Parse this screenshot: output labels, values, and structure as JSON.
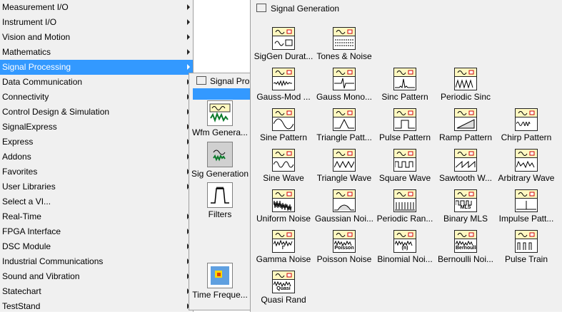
{
  "menu": {
    "items": [
      {
        "label": "Measurement I/O",
        "submenu": true
      },
      {
        "label": "Instrument I/O",
        "submenu": true
      },
      {
        "label": "Vision and Motion",
        "submenu": true
      },
      {
        "label": "Mathematics",
        "submenu": true
      },
      {
        "label": "Signal Processing",
        "submenu": true,
        "selected": true
      },
      {
        "label": "Data Communication",
        "submenu": true
      },
      {
        "label": "Connectivity",
        "submenu": true
      },
      {
        "label": "Control Design & Simulation",
        "submenu": true
      },
      {
        "label": "SignalExpress",
        "submenu": true
      },
      {
        "label": "Express",
        "submenu": true
      },
      {
        "label": "Addons",
        "submenu": true
      },
      {
        "label": "Favorites",
        "submenu": true
      },
      {
        "label": "User Libraries",
        "submenu": true
      },
      {
        "label": "Select a VI...",
        "submenu": false
      },
      {
        "label": "Real-Time",
        "submenu": true
      },
      {
        "label": "FPGA Interface",
        "submenu": true
      },
      {
        "label": "DSC Module",
        "submenu": true
      },
      {
        "label": "Industrial Communications",
        "submenu": true
      },
      {
        "label": "Sound and Vibration",
        "submenu": true
      },
      {
        "label": "Statechart",
        "submenu": true
      },
      {
        "label": "TestStand",
        "submenu": true
      }
    ]
  },
  "subpalette": {
    "title": "Signal Pro",
    "items": [
      {
        "label": "Wfm Genera...",
        "icon": "waveform-generation-icon"
      },
      {
        "label": "Sig Generation",
        "icon": "signal-generation-icon"
      },
      {
        "label": "Filters",
        "icon": "filters-icon"
      },
      {
        "label": "Time Freque...",
        "icon": "time-frequency-icon"
      }
    ]
  },
  "palette": {
    "title": "Signal Generation",
    "items": [
      {
        "label": "SigGen Durat...",
        "icon": "siggen-duration-icon",
        "row": 0,
        "col": 0
      },
      {
        "label": "Tones & Noise",
        "icon": "tones-noise-icon",
        "row": 0,
        "col": 1
      },
      {
        "label": "Gauss-Mod ...",
        "icon": "gauss-mod-icon",
        "row": 1,
        "col": 0
      },
      {
        "label": "Gauss Mono...",
        "icon": "gauss-mono-icon",
        "row": 1,
        "col": 1
      },
      {
        "label": "Sinc Pattern",
        "icon": "sinc-pattern-icon",
        "row": 1,
        "col": 2
      },
      {
        "label": "Periodic Sinc",
        "icon": "periodic-sinc-icon",
        "row": 1,
        "col": 3
      },
      {
        "label": "Sine Pattern",
        "icon": "sine-pattern-icon",
        "row": 2,
        "col": 0
      },
      {
        "label": "Triangle Patt...",
        "icon": "triangle-pattern-icon",
        "row": 2,
        "col": 1
      },
      {
        "label": "Pulse Pattern",
        "icon": "pulse-pattern-icon",
        "row": 2,
        "col": 2
      },
      {
        "label": "Ramp Pattern",
        "icon": "ramp-pattern-icon",
        "row": 2,
        "col": 3
      },
      {
        "label": "Chirp Pattern",
        "icon": "chirp-pattern-icon",
        "row": 2,
        "col": 4
      },
      {
        "label": "Sine Wave",
        "icon": "sine-wave-icon",
        "row": 3,
        "col": 0
      },
      {
        "label": "Triangle Wave",
        "icon": "triangle-wave-icon",
        "row": 3,
        "col": 1
      },
      {
        "label": "Square Wave",
        "icon": "square-wave-icon",
        "row": 3,
        "col": 2
      },
      {
        "label": "Sawtooth W...",
        "icon": "sawtooth-wave-icon",
        "row": 3,
        "col": 3
      },
      {
        "label": "Arbitrary Wave",
        "icon": "arbitrary-wave-icon",
        "row": 3,
        "col": 4
      },
      {
        "label": "Uniform Noise",
        "icon": "uniform-noise-icon",
        "row": 4,
        "col": 0
      },
      {
        "label": "Gaussian Noi...",
        "icon": "gaussian-noise-icon",
        "row": 4,
        "col": 1
      },
      {
        "label": "Periodic Ran...",
        "icon": "periodic-random-noise-icon",
        "row": 4,
        "col": 2
      },
      {
        "label": "Binary MLS",
        "icon": "binary-mls-icon",
        "row": 4,
        "col": 3,
        "tag": "MLS"
      },
      {
        "label": "Impulse Patt...",
        "icon": "impulse-pattern-icon",
        "row": 4,
        "col": 4
      },
      {
        "label": "Gamma Noise",
        "icon": "gamma-noise-icon",
        "row": 5,
        "col": 0,
        "tag": "Γ"
      },
      {
        "label": "Poisson Noise",
        "icon": "poisson-noise-icon",
        "row": 5,
        "col": 1,
        "tag": "Poisson"
      },
      {
        "label": "Binomial Noi...",
        "icon": "binomial-noise-icon",
        "row": 5,
        "col": 2,
        "tag": "(n)"
      },
      {
        "label": "Bernoulli Noi...",
        "icon": "bernoulli-noise-icon",
        "row": 5,
        "col": 3,
        "tag": "Bernoulli"
      },
      {
        "label": "Pulse Train",
        "icon": "pulse-train-icon",
        "row": 5,
        "col": 4
      },
      {
        "label": "Quasi Rand",
        "icon": "quasi-random-icon",
        "row": 6,
        "col": 0,
        "tag": "Quasi"
      }
    ]
  },
  "colors": {
    "selection": "#3399ff",
    "menu_bg": "#f0f0f0",
    "icon_band": "#fff8c0"
  }
}
